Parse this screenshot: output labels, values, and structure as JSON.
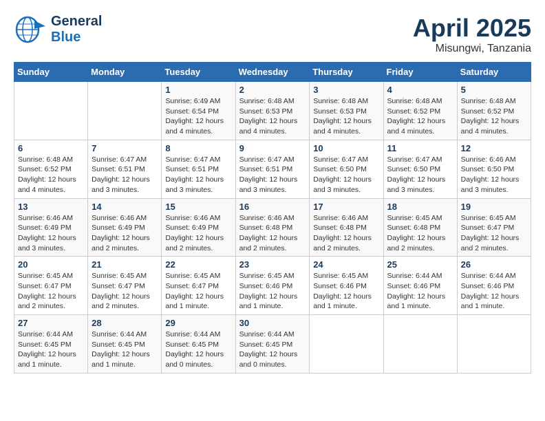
{
  "header": {
    "logo_line1": "General",
    "logo_line2": "Blue",
    "month": "April 2025",
    "location": "Misungwi, Tanzania"
  },
  "weekdays": [
    "Sunday",
    "Monday",
    "Tuesday",
    "Wednesday",
    "Thursday",
    "Friday",
    "Saturday"
  ],
  "weeks": [
    [
      {
        "day": "",
        "info": ""
      },
      {
        "day": "",
        "info": ""
      },
      {
        "day": "1",
        "info": "Sunrise: 6:49 AM\nSunset: 6:54 PM\nDaylight: 12 hours\nand 4 minutes."
      },
      {
        "day": "2",
        "info": "Sunrise: 6:48 AM\nSunset: 6:53 PM\nDaylight: 12 hours\nand 4 minutes."
      },
      {
        "day": "3",
        "info": "Sunrise: 6:48 AM\nSunset: 6:53 PM\nDaylight: 12 hours\nand 4 minutes."
      },
      {
        "day": "4",
        "info": "Sunrise: 6:48 AM\nSunset: 6:52 PM\nDaylight: 12 hours\nand 4 minutes."
      },
      {
        "day": "5",
        "info": "Sunrise: 6:48 AM\nSunset: 6:52 PM\nDaylight: 12 hours\nand 4 minutes."
      }
    ],
    [
      {
        "day": "6",
        "info": "Sunrise: 6:48 AM\nSunset: 6:52 PM\nDaylight: 12 hours\nand 4 minutes."
      },
      {
        "day": "7",
        "info": "Sunrise: 6:47 AM\nSunset: 6:51 PM\nDaylight: 12 hours\nand 3 minutes."
      },
      {
        "day": "8",
        "info": "Sunrise: 6:47 AM\nSunset: 6:51 PM\nDaylight: 12 hours\nand 3 minutes."
      },
      {
        "day": "9",
        "info": "Sunrise: 6:47 AM\nSunset: 6:51 PM\nDaylight: 12 hours\nand 3 minutes."
      },
      {
        "day": "10",
        "info": "Sunrise: 6:47 AM\nSunset: 6:50 PM\nDaylight: 12 hours\nand 3 minutes."
      },
      {
        "day": "11",
        "info": "Sunrise: 6:47 AM\nSunset: 6:50 PM\nDaylight: 12 hours\nand 3 minutes."
      },
      {
        "day": "12",
        "info": "Sunrise: 6:46 AM\nSunset: 6:50 PM\nDaylight: 12 hours\nand 3 minutes."
      }
    ],
    [
      {
        "day": "13",
        "info": "Sunrise: 6:46 AM\nSunset: 6:49 PM\nDaylight: 12 hours\nand 3 minutes."
      },
      {
        "day": "14",
        "info": "Sunrise: 6:46 AM\nSunset: 6:49 PM\nDaylight: 12 hours\nand 2 minutes."
      },
      {
        "day": "15",
        "info": "Sunrise: 6:46 AM\nSunset: 6:49 PM\nDaylight: 12 hours\nand 2 minutes."
      },
      {
        "day": "16",
        "info": "Sunrise: 6:46 AM\nSunset: 6:48 PM\nDaylight: 12 hours\nand 2 minutes."
      },
      {
        "day": "17",
        "info": "Sunrise: 6:46 AM\nSunset: 6:48 PM\nDaylight: 12 hours\nand 2 minutes."
      },
      {
        "day": "18",
        "info": "Sunrise: 6:45 AM\nSunset: 6:48 PM\nDaylight: 12 hours\nand 2 minutes."
      },
      {
        "day": "19",
        "info": "Sunrise: 6:45 AM\nSunset: 6:47 PM\nDaylight: 12 hours\nand 2 minutes."
      }
    ],
    [
      {
        "day": "20",
        "info": "Sunrise: 6:45 AM\nSunset: 6:47 PM\nDaylight: 12 hours\nand 2 minutes."
      },
      {
        "day": "21",
        "info": "Sunrise: 6:45 AM\nSunset: 6:47 PM\nDaylight: 12 hours\nand 2 minutes."
      },
      {
        "day": "22",
        "info": "Sunrise: 6:45 AM\nSunset: 6:47 PM\nDaylight: 12 hours\nand 1 minute."
      },
      {
        "day": "23",
        "info": "Sunrise: 6:45 AM\nSunset: 6:46 PM\nDaylight: 12 hours\nand 1 minute."
      },
      {
        "day": "24",
        "info": "Sunrise: 6:45 AM\nSunset: 6:46 PM\nDaylight: 12 hours\nand 1 minute."
      },
      {
        "day": "25",
        "info": "Sunrise: 6:44 AM\nSunset: 6:46 PM\nDaylight: 12 hours\nand 1 minute."
      },
      {
        "day": "26",
        "info": "Sunrise: 6:44 AM\nSunset: 6:46 PM\nDaylight: 12 hours\nand 1 minute."
      }
    ],
    [
      {
        "day": "27",
        "info": "Sunrise: 6:44 AM\nSunset: 6:45 PM\nDaylight: 12 hours\nand 1 minute."
      },
      {
        "day": "28",
        "info": "Sunrise: 6:44 AM\nSunset: 6:45 PM\nDaylight: 12 hours\nand 1 minute."
      },
      {
        "day": "29",
        "info": "Sunrise: 6:44 AM\nSunset: 6:45 PM\nDaylight: 12 hours\nand 0 minutes."
      },
      {
        "day": "30",
        "info": "Sunrise: 6:44 AM\nSunset: 6:45 PM\nDaylight: 12 hours\nand 0 minutes."
      },
      {
        "day": "",
        "info": ""
      },
      {
        "day": "",
        "info": ""
      },
      {
        "day": "",
        "info": ""
      }
    ]
  ]
}
